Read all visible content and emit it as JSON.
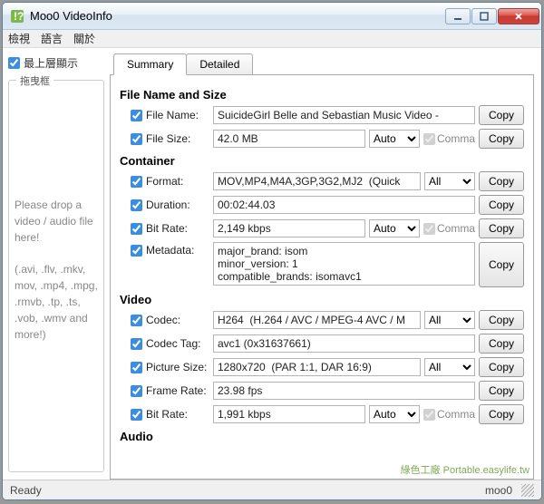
{
  "window": {
    "title": "Moo0 VideoInfo"
  },
  "menu": {
    "view": "檢視",
    "language": "語言",
    "about": "關於"
  },
  "sidebar": {
    "topmost": "最上層顯示",
    "dropbox_title": "拖曳框",
    "dropmsg1": "Please drop a video / audio file here!",
    "dropmsg2": "(.avi, .flv, .mkv, mov, .mp4, .mpg, .rmvb, .tp, .ts, .vob, .wmv and more!)"
  },
  "tabs": {
    "summary": "Summary",
    "detailed": "Detailed"
  },
  "labels": {
    "copy": "Copy",
    "comma": "Comma",
    "auto": "Auto",
    "all": "All"
  },
  "sections": {
    "fns": {
      "title": "File Name and Size",
      "filename_lbl": "File Name:",
      "filename_val": "SuicideGirl Belle and Sebastian Music Video -",
      "filesize_lbl": "File Size:",
      "filesize_val": "42.0 MB"
    },
    "container": {
      "title": "Container",
      "format_lbl": "Format:",
      "format_val": "MOV,MP4,M4A,3GP,3G2,MJ2  (Quick",
      "duration_lbl": "Duration:",
      "duration_val": "00:02:44.03",
      "bitrate_lbl": "Bit Rate:",
      "bitrate_val": "2,149 kbps",
      "metadata_lbl": "Metadata:",
      "metadata_val": "major_brand: isom\nminor_version: 1\ncompatible_brands: isomavc1"
    },
    "video": {
      "title": "Video",
      "codec_lbl": "Codec:",
      "codec_val": "H264  (H.264 / AVC / MPEG-4 AVC / M",
      "codectag_lbl": "Codec Tag:",
      "codectag_val": "avc1 (0x31637661)",
      "picsize_lbl": "Picture Size:",
      "picsize_val": "1280x720  (PAR 1:1, DAR 16:9)",
      "framerate_lbl": "Frame Rate:",
      "framerate_val": "23.98 fps",
      "bitrate_lbl": "Bit Rate:",
      "bitrate_val": "1,991 kbps"
    },
    "audio": {
      "title": "Audio"
    }
  },
  "status": {
    "ready": "Ready",
    "right": "moo0"
  },
  "watermark": "綠色工廠 Portable.easylife.tw"
}
